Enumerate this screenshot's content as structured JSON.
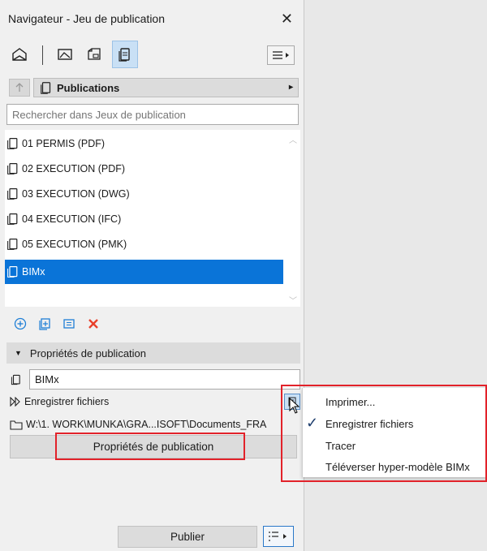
{
  "window": {
    "title": "Navigateur - Jeu de publication",
    "close_symbol": "✕"
  },
  "tabs": [
    {
      "name": "project-map",
      "icon": "house-icon"
    },
    {
      "name": "view-map",
      "icon": "view-icon"
    },
    {
      "name": "layout-book",
      "icon": "layout-icon"
    },
    {
      "name": "publisher-sets",
      "icon": "publisher-icon",
      "active": true
    }
  ],
  "selector": {
    "label": "Publications",
    "arrow": "▸"
  },
  "search": {
    "placeholder": "Rechercher dans Jeux de publication"
  },
  "list": {
    "items": [
      {
        "label": "01 PERMIS (PDF)",
        "selected": false
      },
      {
        "label": "02 EXECUTION (PDF)",
        "selected": false
      },
      {
        "label": "03 EXECUTION (DWG)",
        "selected": false
      },
      {
        "label": "04 EXECUTION (IFC)",
        "selected": false
      },
      {
        "label": "05 EXECUTION (PMK)",
        "selected": false
      },
      {
        "label": "BIMx",
        "selected": true
      }
    ]
  },
  "properties": {
    "header": "Propriétés de publication",
    "name_value": "BIMx",
    "method_label": "Enregistrer fichiers",
    "path": "W:\\1. WORK\\MUNKA\\GRA...ISOFT\\Documents_FRA",
    "properties_button": "Propriétés de publication"
  },
  "bottom": {
    "publish_button": "Publier"
  },
  "popup_menu": {
    "items": [
      {
        "label": "Imprimer...",
        "checked": false
      },
      {
        "label": "Enregistrer fichiers",
        "checked": true
      },
      {
        "label": "Tracer",
        "checked": false
      },
      {
        "label": "Téléverser hyper-modèle BIMx",
        "checked": false
      }
    ]
  },
  "colors": {
    "selection": "#0a74d8",
    "highlight_box": "#e2222a",
    "active_tab": "#c9e0f5",
    "delete_icon": "#e8402a",
    "add_icon": "#1f7fd6"
  }
}
